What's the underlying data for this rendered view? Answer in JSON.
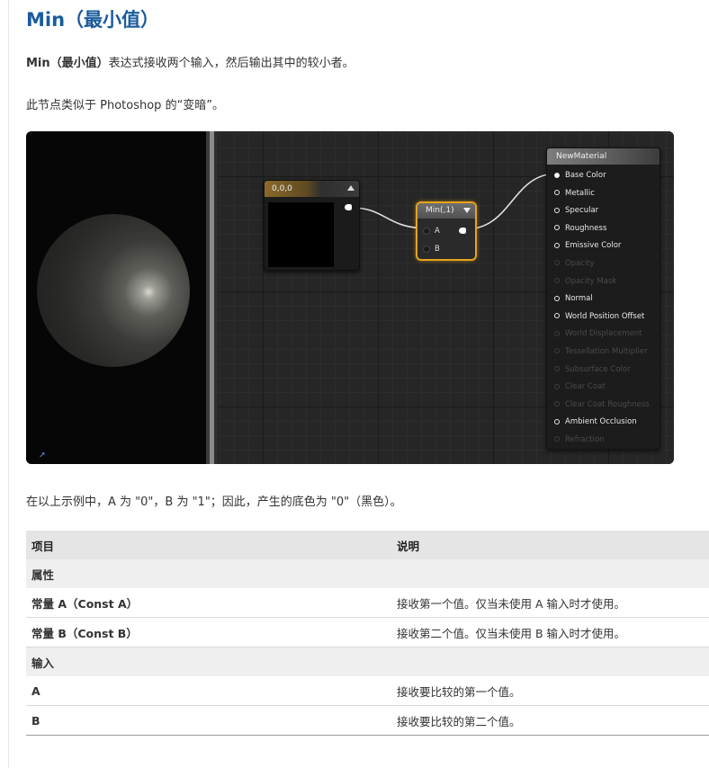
{
  "title": "Min（最小值）",
  "intro": {
    "term": "Min（最小值）",
    "text": "表达式接收两个输入，然后输出其中的较小者。"
  },
  "note": "此节点类似于 Photoshop 的“变暗”。",
  "example_text": "在以上示例中，A 为 \"0\"，B 为 \"1\"；因此，产生的底色为 \"0\"（黑色）。",
  "graph": {
    "const_node": {
      "title": "0,0,0"
    },
    "min_node": {
      "title": "Min(,1)",
      "pin_a": "A",
      "pin_b": "B"
    },
    "material_node": {
      "title": "NewMaterial",
      "pins": [
        {
          "label": "Base Color",
          "enabled": true,
          "connected": true
        },
        {
          "label": "Metallic",
          "enabled": true,
          "connected": false
        },
        {
          "label": "Specular",
          "enabled": true,
          "connected": false
        },
        {
          "label": "Roughness",
          "enabled": true,
          "connected": false
        },
        {
          "label": "Emissive Color",
          "enabled": true,
          "connected": false
        },
        {
          "label": "Opacity",
          "enabled": false,
          "connected": false
        },
        {
          "label": "Opacity Mask",
          "enabled": false,
          "connected": false
        },
        {
          "label": "Normal",
          "enabled": true,
          "connected": false
        },
        {
          "label": "World Position Offset",
          "enabled": true,
          "connected": false
        },
        {
          "label": "World Displacement",
          "enabled": false,
          "connected": false
        },
        {
          "label": "Tessellation Multiplier",
          "enabled": false,
          "connected": false
        },
        {
          "label": "Subsurface Color",
          "enabled": false,
          "connected": false
        },
        {
          "label": "Clear Coat",
          "enabled": false,
          "connected": false
        },
        {
          "label": "Clear Coat Roughness",
          "enabled": false,
          "connected": false
        },
        {
          "label": "Ambient Occlusion",
          "enabled": true,
          "connected": false
        },
        {
          "label": "Refraction",
          "enabled": false,
          "connected": false
        }
      ]
    },
    "colors": {
      "highlight": "#e4a31c",
      "wire": "#e0e0e0"
    }
  },
  "table": {
    "headers": [
      "项目",
      "说明"
    ],
    "sections": [
      {
        "label": "属性",
        "rows": [
          {
            "key": "常量 A（Const A）",
            "value": "接收第一个值。仅当未使用 A 输入时才使用。"
          },
          {
            "key": "常量 B（Const B）",
            "value": "接收第二个值。仅当未使用 B 输入时才使用。"
          }
        ]
      },
      {
        "label": "输入",
        "rows": [
          {
            "key": "A",
            "value": "接收要比较的第一个值。"
          },
          {
            "key": "B",
            "value": "接收要比较的第二个值。"
          }
        ]
      }
    ]
  },
  "colors": {
    "heading": "#1a5b9c"
  }
}
